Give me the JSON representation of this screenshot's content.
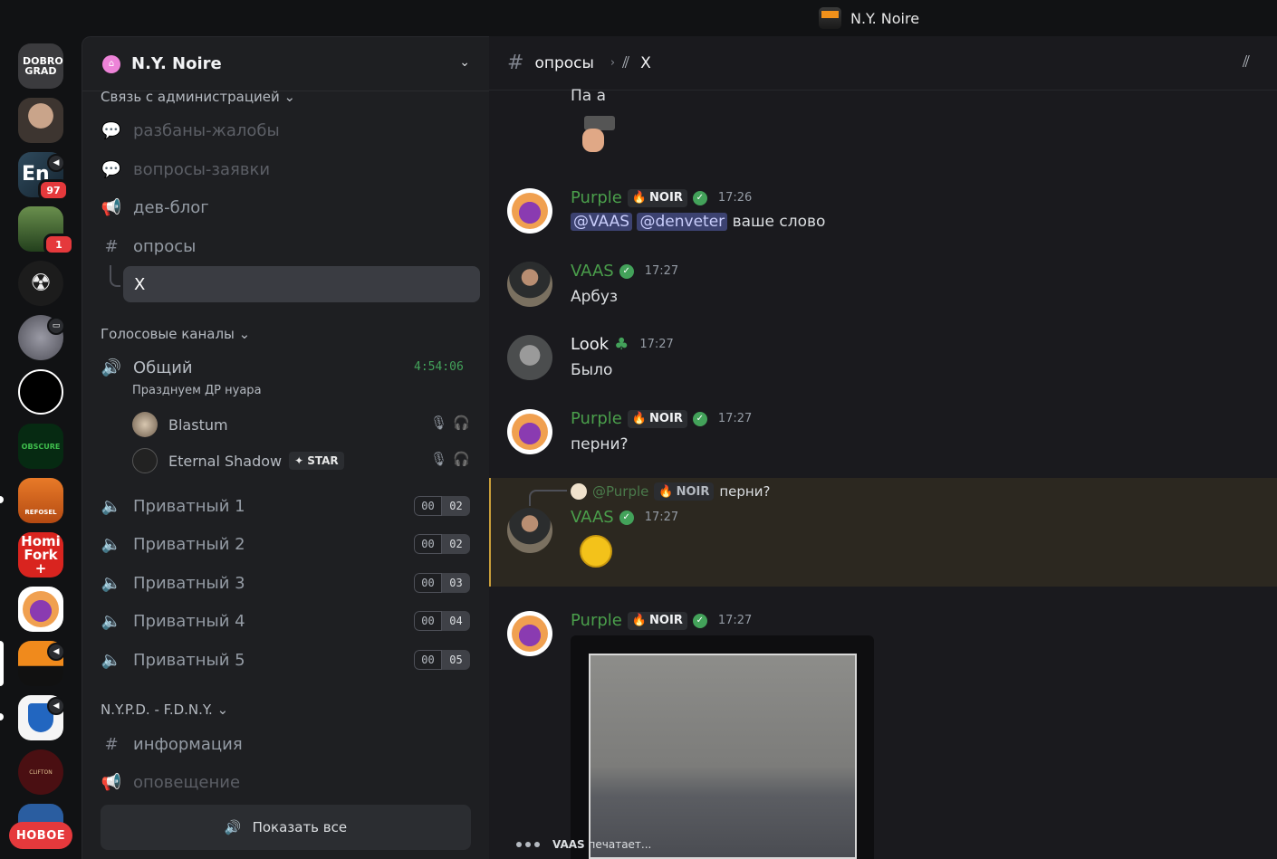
{
  "titlebar": {
    "server_name": "N.Y. Noire"
  },
  "rail": {
    "servers": [
      "DOBRO GRAD",
      "",
      "",
      "",
      "",
      "",
      "",
      "",
      "OBSCURE",
      "REFOSEL",
      "Homi Fork +",
      "N.Y. Noire",
      "",
      "",
      "CLIFTON",
      ""
    ],
    "badge_1": "97",
    "badge_2": "1",
    "new_label": "НОВОЕ"
  },
  "sidebar": {
    "guild_name": "N.Y. Noire",
    "cat_admin": "Связь с администрацией",
    "ch_bans": "разбаны-жалобы",
    "ch_requests": "вопросы-заявки",
    "ch_devblog": "дев-блог",
    "ch_polls": "опросы",
    "thread_x": "X",
    "cat_voice": "Голосовые каналы",
    "voice_general": "Общий",
    "voice_general_timer": "4:54:06",
    "voice_general_status": "Празднуем ДР нуара",
    "user_blastum": "Blastum",
    "user_eternal": "Eternal Shadow",
    "user_eternal_tag": "STAR",
    "private": [
      {
        "name": "Приватный 1",
        "count": "00",
        "limit": "02"
      },
      {
        "name": "Приватный 2",
        "count": "00",
        "limit": "02"
      },
      {
        "name": "Приватный 3",
        "count": "00",
        "limit": "03"
      },
      {
        "name": "Приватный 4",
        "count": "00",
        "limit": "04"
      },
      {
        "name": "Приватный 5",
        "count": "00",
        "limit": "05"
      }
    ],
    "cat_nypd": "N.Y.P.D. - F.D.N.Y.",
    "ch_info": "информация",
    "ch_announce": "оповещение",
    "show_all": "Показать все"
  },
  "chat": {
    "channel": "опросы",
    "thread": "X",
    "cut_text": "Па а",
    "messages": [
      {
        "user": "Purple",
        "tag": "NOIR",
        "time": "17:26",
        "mention1": "@VAAS",
        "mention2": "@denveter",
        "text": "ваше слово"
      },
      {
        "user": "VAAS",
        "time": "17:27",
        "text": "Арбуз"
      },
      {
        "user": "Look",
        "time": "17:27",
        "text": "Было"
      },
      {
        "user": "Purple",
        "tag": "NOIR",
        "time": "17:27",
        "text": "перни?"
      },
      {
        "user": "VAAS",
        "time": "17:27",
        "reply_user": "@Purple",
        "reply_tag": "NOIR",
        "reply_text": "перни?"
      },
      {
        "user": "Purple",
        "tag": "NOIR",
        "time": "17:27"
      }
    ],
    "typing_user": "VAAS",
    "typing_text": "печатает..."
  }
}
